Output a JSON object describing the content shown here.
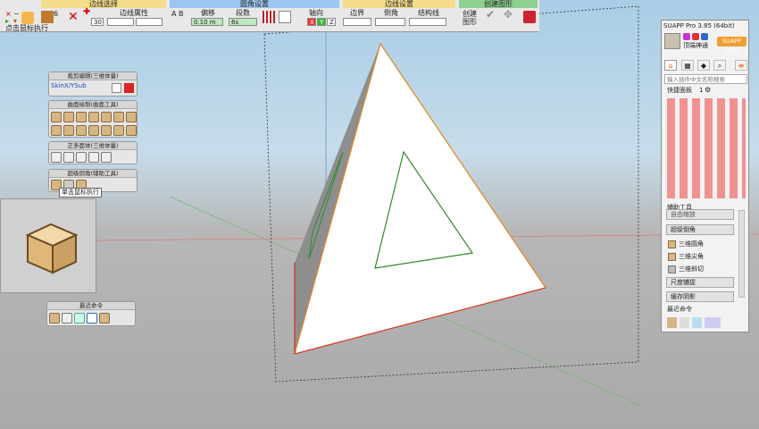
{
  "toolbar": {
    "sections": {
      "edge_select": "边线选择",
      "fillet_settings": "圆角设置",
      "edge_settings": "边线设置",
      "create_shape": "创建图形"
    },
    "edge_property": "边线属性",
    "offset_label": "偏移",
    "offset_value": "0.10 m",
    "segments_label": "段数",
    "segments_value": "6s",
    "axis_label": "轴向",
    "axis_x": "X",
    "axis_y": "Y",
    "axis_z": "Z",
    "boundary_label": "边界",
    "chamfer_label": "倒角",
    "structure_label": "结构线",
    "create_shape_btn": "创建\n图形",
    "num_30": "30",
    "num_6": "6",
    "ab_label": "A B",
    "status_text": "点击鼠标执行"
  },
  "panels": {
    "trim": {
      "title": "裁剪编辑(三维体量)",
      "label": "SkinX/YSub"
    },
    "surface": {
      "title": "曲面绘制(曲面工具)"
    },
    "solid": {
      "title": "正多面体(三维体量)"
    },
    "fillet": {
      "title": "超级倒角(辅助工具)",
      "tooltip": "单击鼠标执行"
    },
    "recent": {
      "title": "最近命令"
    }
  },
  "suapp": {
    "title": "SUAPP Pro 3.85 (64bit)",
    "badge": "SUAPP 3.85",
    "user": "顶端神通",
    "search_placeholder": "输入插件中文名称搜索",
    "quick_panel": "快捷面板",
    "quick_num": "1",
    "aux_tools": "辅助工具",
    "items": [
      "自由缩放",
      "超级倒角",
      "三维圆角",
      "三维尖角",
      "三维斜切",
      "尺度辅捉",
      "缓存阴影"
    ],
    "recent_label": "最近命令"
  },
  "colors": {
    "accent": "#f0a030",
    "green_header": "#8ed08e",
    "blue_header": "#9cc6ef",
    "yellow_header": "#f5dc8c"
  }
}
